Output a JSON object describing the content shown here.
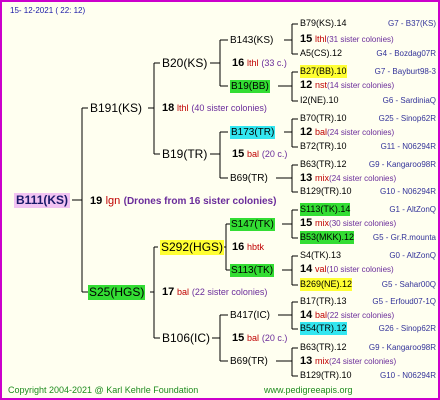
{
  "header": {
    "date_text": "15- 12-2021 ( 22: 12)"
  },
  "root": {
    "label": "B111(KS)",
    "num": "19",
    "breed": "lgn",
    "note": "(Drones from 16 sister colonies)"
  },
  "gen1": [
    {
      "label": "B191(KS)",
      "num": "18",
      "breed": "lthl",
      "note": "(40 sister colonies)"
    },
    {
      "label": "S25(HGS)",
      "num": "17",
      "breed": "bal",
      "note": "(22 sister colonies)"
    }
  ],
  "gen2": [
    {
      "label": "B20(KS)",
      "num": "16",
      "breed": "lthl",
      "note": "(33 c.)"
    },
    {
      "label": "B19(TR)",
      "num": "15",
      "breed": "bal",
      "note": "(20 c.)"
    },
    {
      "label": "S292(HGS)",
      "num": "16",
      "breed": "hbtk",
      "note": ""
    },
    {
      "label": "B106(IC)",
      "num": "15",
      "breed": "bal",
      "note": "(20 c.)"
    }
  ],
  "gen3": [
    {
      "label": "B143(KS)"
    },
    {
      "label": "B19(BB)"
    },
    {
      "label": "B173(TR)"
    },
    {
      "label": "B69(TR)"
    },
    {
      "label": "S147(TK)"
    },
    {
      "label": "S113(TK)"
    },
    {
      "label": "B417(IC)"
    },
    {
      "label": "B69(TR)"
    }
  ],
  "gen4": [
    {
      "label": "B79(KS).14",
      "right": "G7 - B37(KS)"
    },
    {
      "num": "15",
      "breed": "lthl",
      "note": "(31 sister colonies)"
    },
    {
      "label": "A5(CS).12",
      "right": "G4 - Bozdag07R"
    },
    {
      "label": "B27(BB).10",
      "right": "G7 - Bayburt98-3"
    },
    {
      "num": "12",
      "breed": "nst",
      "note": "(14 sister colonies)"
    },
    {
      "label": "I2(NE).10",
      "right": "G6 - SardiniaQ"
    },
    {
      "label": "B70(TR).10",
      "right": "G25 - Sinop62R"
    },
    {
      "num": "12",
      "breed": "bal",
      "note": "(24 sister colonies)"
    },
    {
      "label": "B72(TR).10",
      "right": "G11 - N06294R"
    },
    {
      "label": "B63(TR).12",
      "right": "G9 - Kangaroo98R"
    },
    {
      "num": "13",
      "breed": "mix",
      "note": "(24 sister colonies)"
    },
    {
      "label": "B129(TR).10",
      "right": "G10 - N06294R"
    },
    {
      "label": "S113(TK).14",
      "right": "G1 - AltZonQ"
    },
    {
      "num": "15",
      "breed": "mix",
      "note": "(30 sister colonies)"
    },
    {
      "label": "B53(MKK).12",
      "right": "G5 - Gr.R.mounta"
    },
    {
      "label": "S4(TK).13",
      "right": "G0 - AltZonQ"
    },
    {
      "num": "14",
      "breed": "val",
      "note": "(10 sister colonies)"
    },
    {
      "label": "B269(NE).12",
      "right": "G5 - Sahar00Q"
    },
    {
      "label": "B17(TR).13",
      "right": "G5 - Erfoud07-1Q"
    },
    {
      "num": "14",
      "breed": "bal",
      "note": "(22 sister colonies)"
    },
    {
      "label": "B54(TR).12",
      "right": "G26 - Sinop62R"
    },
    {
      "label": "B63(TR).12",
      "right": "G9 - Kangaroo98R"
    },
    {
      "num": "13",
      "breed": "mix",
      "note": "(24 sister colonies)"
    },
    {
      "label": "B129(TR).10",
      "right": "G10 - N06294R"
    }
  ],
  "footer": {
    "copyright": "Copyright 2004-2021 @ Karl Kehrle Foundation",
    "url": "www.pedigreeapis.org"
  }
}
